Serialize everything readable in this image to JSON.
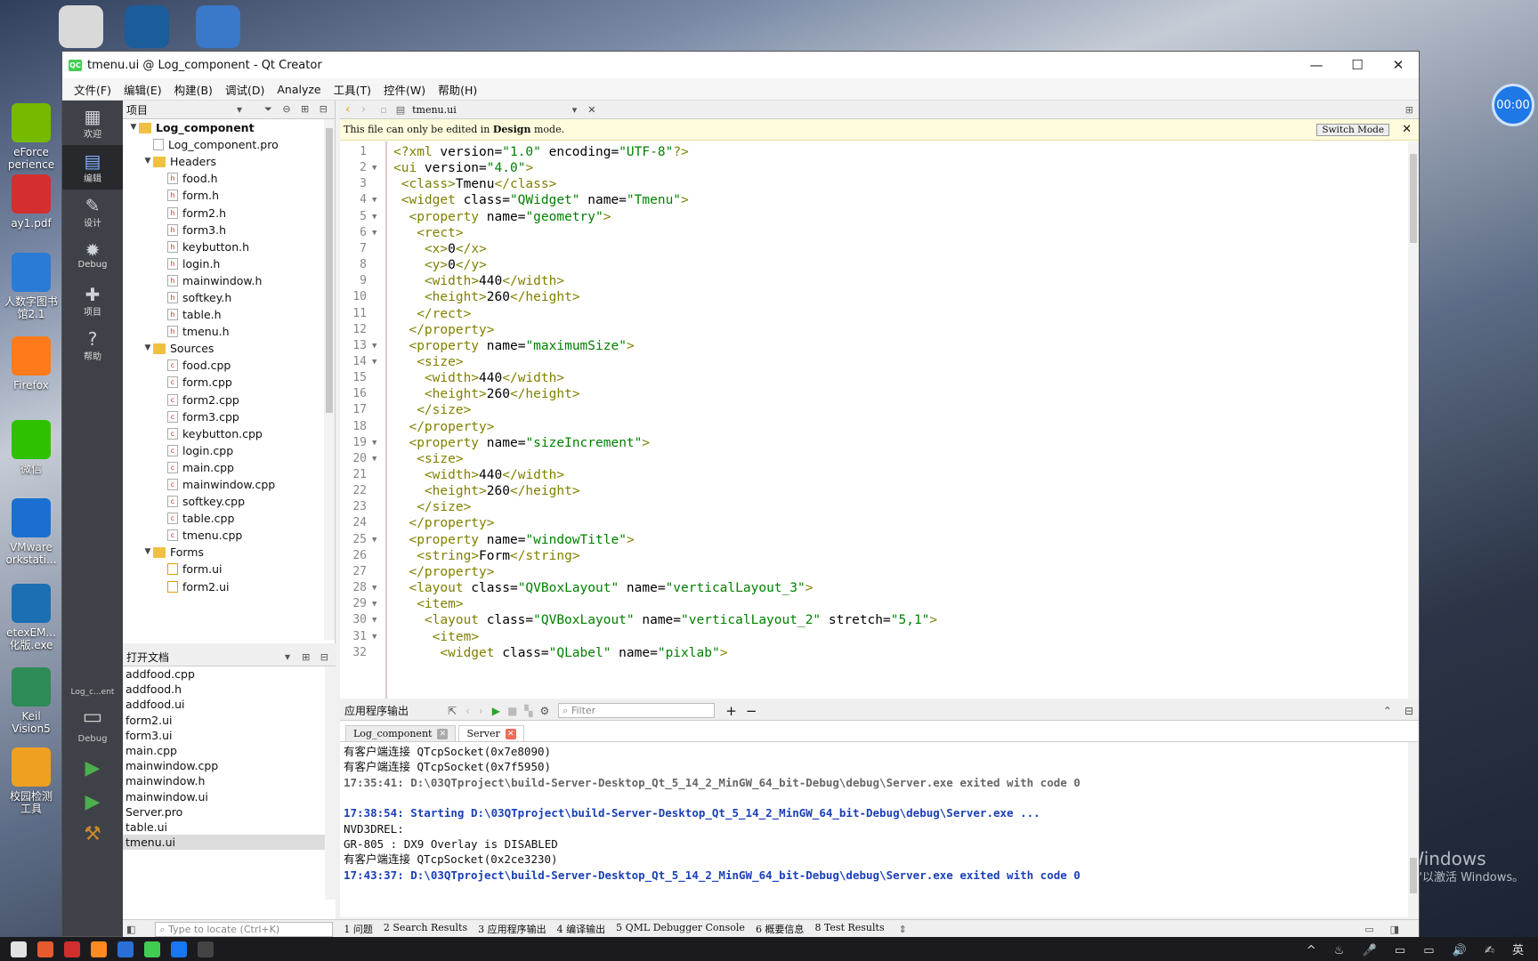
{
  "desktop": {
    "icons": [
      {
        "label": "eForce\nperience",
        "color": "#76b900"
      },
      {
        "label": "ay1.pdf",
        "color": "#d32f2f"
      },
      {
        "label": "人数字图书\n馆2.1",
        "color": "#2a7bd6"
      },
      {
        "label": "Firefox",
        "color": "#ff7a1a"
      },
      {
        "label": "微信",
        "color": "#2dc100"
      },
      {
        "label": "VMware\norkstati...",
        "color": "#1b6fd1"
      },
      {
        "label": "etexEM...\n化版.exe",
        "color": "#1d6fb3"
      },
      {
        "label": "Keil\nVision5",
        "color": "#2e8b57"
      },
      {
        "label": "校园检测\n工具",
        "color": "#f0a020"
      }
    ],
    "top_icons": [
      {
        "name": "unity",
        "color": "#d9d9d9"
      },
      {
        "name": "steam",
        "color": "#1b5c9a"
      },
      {
        "name": "trainer",
        "color": "#3a78c9"
      }
    ],
    "timer": "00:00",
    "watermark": {
      "line1": "激活 Windows",
      "line2": "转到\"设置\"以激活 Windows。"
    }
  },
  "window": {
    "title": "tmenu.ui @ Log_component - Qt Creator",
    "menus": [
      "文件(F)",
      "编辑(E)",
      "构建(B)",
      "调试(D)",
      "Analyze",
      "工具(T)",
      "控件(W)",
      "帮助(H)"
    ]
  },
  "modes": [
    {
      "label": "欢迎",
      "icon": "▦"
    },
    {
      "label": "编辑",
      "icon": "▤"
    },
    {
      "label": "设计",
      "icon": "✎"
    },
    {
      "label": "Debug",
      "icon": "✹"
    },
    {
      "label": "项目",
      "icon": "✚"
    },
    {
      "label": "帮助",
      "icon": "?"
    }
  ],
  "kit": {
    "project": "Log_c...ent",
    "config": "Debug"
  },
  "project_panel": {
    "title": "项目",
    "tree": [
      {
        "label": "Log_component",
        "depth": 0,
        "type": "root"
      },
      {
        "label": "Log_component.pro",
        "depth": 1,
        "type": "file"
      },
      {
        "label": "Headers",
        "depth": 1,
        "type": "folder"
      },
      {
        "label": "food.h",
        "depth": 2,
        "type": "h"
      },
      {
        "label": "form.h",
        "depth": 2,
        "type": "h"
      },
      {
        "label": "form2.h",
        "depth": 2,
        "type": "h"
      },
      {
        "label": "form3.h",
        "depth": 2,
        "type": "h"
      },
      {
        "label": "keybutton.h",
        "depth": 2,
        "type": "h"
      },
      {
        "label": "login.h",
        "depth": 2,
        "type": "h"
      },
      {
        "label": "mainwindow.h",
        "depth": 2,
        "type": "h"
      },
      {
        "label": "softkey.h",
        "depth": 2,
        "type": "h"
      },
      {
        "label": "table.h",
        "depth": 2,
        "type": "h"
      },
      {
        "label": "tmenu.h",
        "depth": 2,
        "type": "h"
      },
      {
        "label": "Sources",
        "depth": 1,
        "type": "folder"
      },
      {
        "label": "food.cpp",
        "depth": 2,
        "type": "c"
      },
      {
        "label": "form.cpp",
        "depth": 2,
        "type": "c"
      },
      {
        "label": "form2.cpp",
        "depth": 2,
        "type": "c"
      },
      {
        "label": "form3.cpp",
        "depth": 2,
        "type": "c"
      },
      {
        "label": "keybutton.cpp",
        "depth": 2,
        "type": "c"
      },
      {
        "label": "login.cpp",
        "depth": 2,
        "type": "c"
      },
      {
        "label": "main.cpp",
        "depth": 2,
        "type": "c"
      },
      {
        "label": "mainwindow.cpp",
        "depth": 2,
        "type": "c"
      },
      {
        "label": "softkey.cpp",
        "depth": 2,
        "type": "c"
      },
      {
        "label": "table.cpp",
        "depth": 2,
        "type": "c"
      },
      {
        "label": "tmenu.cpp",
        "depth": 2,
        "type": "c"
      },
      {
        "label": "Forms",
        "depth": 1,
        "type": "folder"
      },
      {
        "label": "form.ui",
        "depth": 2,
        "type": "ui"
      },
      {
        "label": "form2.ui",
        "depth": 2,
        "type": "ui"
      }
    ]
  },
  "open_docs": {
    "title": "打开文档",
    "items": [
      "addfood.cpp",
      "addfood.h",
      "addfood.ui",
      "form2.ui",
      "form3.ui",
      "main.cpp",
      "mainwindow.cpp",
      "mainwindow.h",
      "mainwindow.ui",
      "Server.pro",
      "table.ui",
      "tmenu.ui"
    ],
    "selected": "tmenu.ui"
  },
  "editor": {
    "file": "tmenu.ui",
    "info_prefix": "This file can only be edited in ",
    "info_mode": "Design",
    "info_suffix": " mode.",
    "switch_button": "Switch Mode",
    "lines": [
      "<?xml version=\"1.0\" encoding=\"UTF-8\"?>",
      "<ui version=\"4.0\">",
      " <class>Tmenu</class>",
      " <widget class=\"QWidget\" name=\"Tmenu\">",
      "  <property name=\"geometry\">",
      "   <rect>",
      "    <x>0</x>",
      "    <y>0</y>",
      "    <width>440</width>",
      "    <height>260</height>",
      "   </rect>",
      "  </property>",
      "  <property name=\"maximumSize\">",
      "   <size>",
      "    <width>440</width>",
      "    <height>260</height>",
      "   </size>",
      "  </property>",
      "  <property name=\"sizeIncrement\">",
      "   <size>",
      "    <width>440</width>",
      "    <height>260</height>",
      "   </size>",
      "  </property>",
      "  <property name=\"windowTitle\">",
      "   <string>Form</string>",
      "  </property>",
      "  <layout class=\"QVBoxLayout\" name=\"verticalLayout_3\">",
      "   <item>",
      "    <layout class=\"QVBoxLayout\" name=\"verticalLayout_2\" stretch=\"5,1\">",
      "     <item>",
      "      <widget class=\"QLabel\" name=\"pixlab\">"
    ],
    "folds": [
      2,
      4,
      5,
      6,
      13,
      14,
      19,
      20,
      25,
      28,
      29,
      30,
      31
    ]
  },
  "output": {
    "title": "应用程序输出",
    "filter_placeholder": "Filter",
    "tabs": [
      {
        "label": "Log_component",
        "active": false
      },
      {
        "label": "Server",
        "active": true
      }
    ],
    "lines": [
      {
        "text": "有客户端连接 QTcpSocket(0x7e8090)",
        "style": "n"
      },
      {
        "text": "有客户端连接 QTcpSocket(0x7f5950)",
        "style": "n"
      },
      {
        "text": "17:35:41: D:\\03QTproject\\build-Server-Desktop_Qt_5_14_2_MinGW_64_bit-Debug\\debug\\Server.exe exited with code 0",
        "style": "g"
      },
      {
        "text": "",
        "style": "n"
      },
      {
        "text": "17:38:54: Starting D:\\03QTproject\\build-Server-Desktop_Qt_5_14_2_MinGW_64_bit-Debug\\debug\\Server.exe ...",
        "style": "b"
      },
      {
        "text": "NVD3DREL:",
        "style": "n"
      },
      {
        "text": "GR-805 : DX9 Overlay is DISABLED",
        "style": "n"
      },
      {
        "text": "有客户端连接 QTcpSocket(0x2ce3230)",
        "style": "n"
      },
      {
        "text": "17:43:37: D:\\03QTproject\\build-Server-Desktop_Qt_5_14_2_MinGW_64_bit-Debug\\debug\\Server.exe exited with code 0",
        "style": "b"
      }
    ]
  },
  "statusbar": {
    "locate_placeholder": "Type to locate (Ctrl+K)",
    "tabs": [
      "1 问题",
      "2 Search Results",
      "3 应用程序输出",
      "4 编译输出",
      "5 QML Debugger Console",
      "6 概要信息",
      "8 Test Results"
    ]
  },
  "taskbar": {
    "tray": "^ ♨ 🎤 ▭ ▭ 🔊 ✍ 英"
  }
}
